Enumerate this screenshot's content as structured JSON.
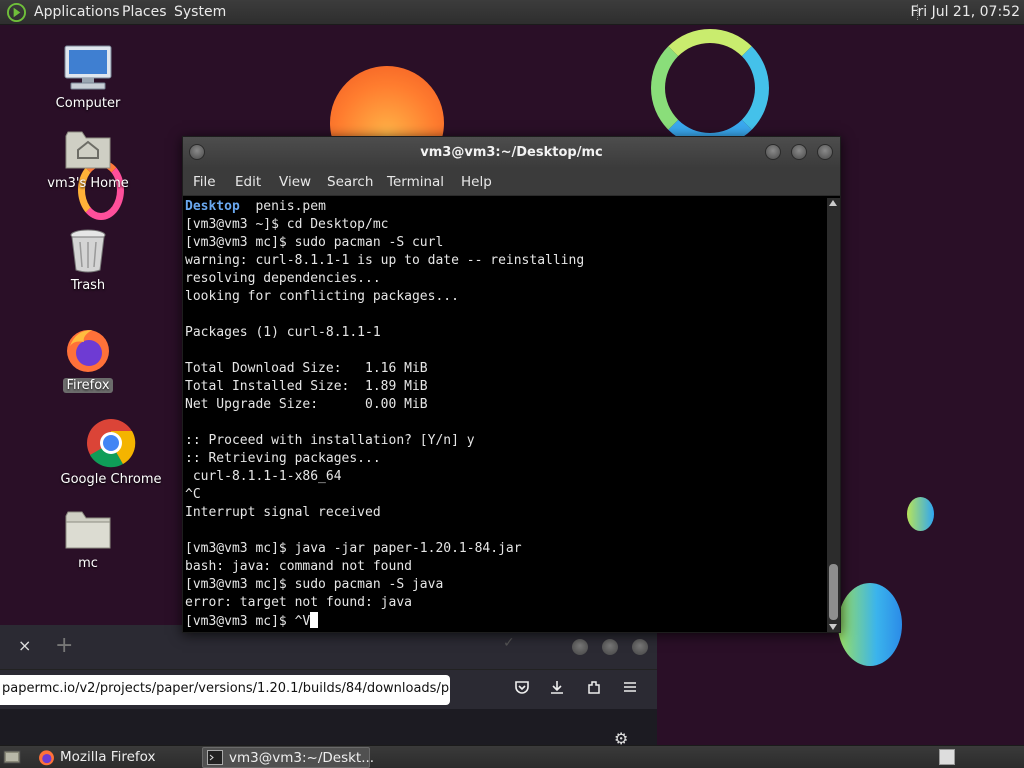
{
  "top_panel": {
    "menus": [
      "Applications",
      "Places",
      "System"
    ],
    "clock": "Fri Jul 21, 07:52"
  },
  "desktop": {
    "icons": [
      {
        "label": "Computer",
        "icon": "computer-icon"
      },
      {
        "label": "vm3's Home",
        "icon": "home-folder-icon"
      },
      {
        "label": "Trash",
        "icon": "trash-icon"
      },
      {
        "label": "Firefox",
        "icon": "firefox-icon",
        "selected": true
      },
      {
        "label": "Google Chrome",
        "icon": "chrome-icon"
      },
      {
        "label": "mc",
        "icon": "folder-icon"
      }
    ]
  },
  "terminal": {
    "title": "vm3@vm3:~/Desktop/mc",
    "menus": [
      "File",
      "Edit",
      "View",
      "Search",
      "Terminal",
      "Help"
    ],
    "first_line": {
      "dir": "Desktop",
      "rest": "  penis.pem"
    },
    "lines": [
      "[vm3@vm3 ~]$ cd Desktop/mc",
      "[vm3@vm3 mc]$ sudo pacman -S curl",
      "warning: curl-8.1.1-1 is up to date -- reinstalling",
      "resolving dependencies...",
      "looking for conflicting packages...",
      "",
      "Packages (1) curl-8.1.1-1",
      "",
      "Total Download Size:   1.16 MiB",
      "Total Installed Size:  1.89 MiB",
      "Net Upgrade Size:      0.00 MiB",
      "",
      ":: Proceed with installation? [Y/n] y",
      ":: Retrieving packages...",
      " curl-8.1.1-1-x86_64",
      "^C",
      "Interrupt signal received",
      "",
      "[vm3@vm3 mc]$ java -jar paper-1.20.1-84.jar",
      "bash: java: command not found",
      "[vm3@vm3 mc]$ sudo pacman -S java",
      "error: target not found: java"
    ],
    "prompt_line": "[vm3@vm3 mc]$ ^V"
  },
  "firefox": {
    "url": "papermc.io/v2/projects/paper/versions/1.20.1/builds/84/downloads/pap",
    "close_tab": "×",
    "new_tab": "+",
    "toolbar_icons": [
      "pocket-icon",
      "download-icon",
      "extensions-icon",
      "menu-icon"
    ]
  },
  "taskbar": {
    "tasks": [
      "Mozilla Firefox",
      "vm3@vm3:~/Deskt..."
    ]
  },
  "colors": {
    "wallpaper": "#2a0f27",
    "terminal_bg": "#000000",
    "directory_blue": "#6aa8f0"
  }
}
